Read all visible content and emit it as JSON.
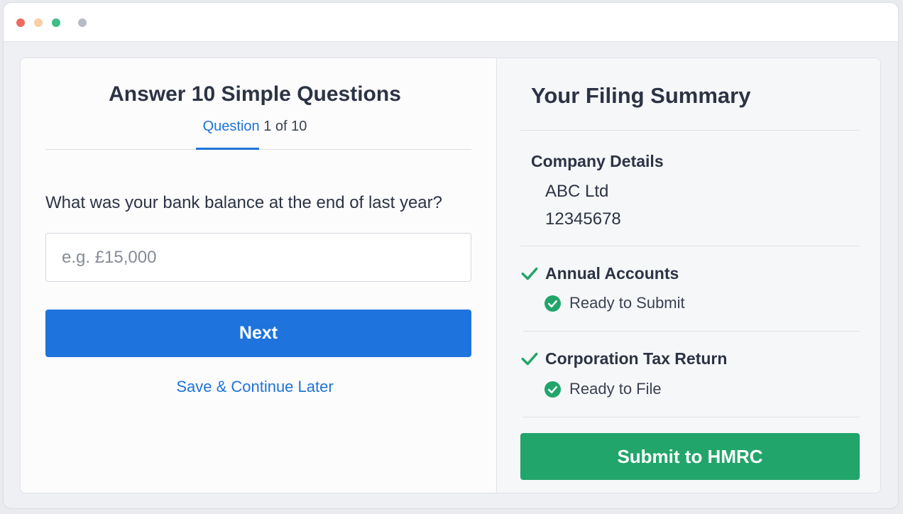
{
  "window": {
    "controls": [
      {
        "name": "close-dot",
        "color": "#ee6b5f"
      },
      {
        "name": "minimize-dot",
        "color": "#f6cfa3"
      },
      {
        "name": "maximize-dot",
        "color": "#3fbd86"
      },
      {
        "name": "extra-dot",
        "color": "#b8bcc6"
      }
    ]
  },
  "questionnaire": {
    "title": "Answer 10 Simple Questions",
    "progress_label": "Question",
    "progress_count": "1 of 10",
    "question": "What was your bank balance at the end of last year?",
    "input_placeholder": "e.g. £15,000",
    "input_value": "",
    "next_label": "Next",
    "save_label": "Save & Continue Later"
  },
  "summary": {
    "title": "Your Filing Summary",
    "company": {
      "heading": "Company Details",
      "name": "ABC Ltd",
      "number": "12345678"
    },
    "items": [
      {
        "heading": "Annual Accounts",
        "status": "Ready to Submit",
        "icon": "check-icon"
      },
      {
        "heading": "Corporation Tax Return",
        "status": "Ready to File",
        "icon": "check-icon"
      }
    ],
    "submit_label": "Submit to HMRC"
  },
  "colors": {
    "accent_blue": "#1e73dc",
    "success_green": "#21a56a",
    "text_dark": "#2c3344"
  }
}
